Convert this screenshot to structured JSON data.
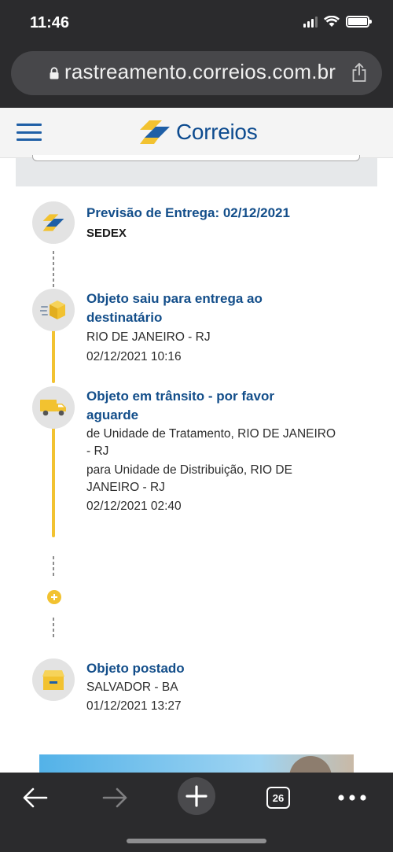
{
  "status_bar": {
    "time": "11:46"
  },
  "browser": {
    "url": "rastreamento.correios.com.br",
    "tab_count": "26"
  },
  "site": {
    "logo_text": "Correios",
    "colors": {
      "brand_blue": "#134e8a",
      "brand_yellow": "#f2c230"
    }
  },
  "tracking": {
    "events": [
      {
        "icon": "delivery-forecast-icon",
        "title": "Previsão de Entrega: 02/12/2021",
        "subtitle": "SEDEX",
        "lines": []
      },
      {
        "icon": "package-out-for-delivery-icon",
        "title_line1": "Objeto saiu para entrega ao",
        "title_line2": "destinatário",
        "lines": [
          "RIO DE JANEIRO - RJ",
          "02/12/2021 10:16"
        ]
      },
      {
        "icon": "truck-icon",
        "title_line1": "Objeto em trânsito - por favor",
        "title_line2": "aguarde",
        "lines": [
          "de Unidade de Tratamento, RIO DE JANEIRO",
          "- RJ",
          "para Unidade de Distribuição, RIO DE",
          "JANEIRO - RJ",
          "02/12/2021 02:40"
        ]
      },
      {
        "icon": "posted-box-icon",
        "title": "Objeto postado",
        "lines": [
          "SALVADOR - BA",
          "01/12/2021 13:27"
        ]
      }
    ]
  }
}
